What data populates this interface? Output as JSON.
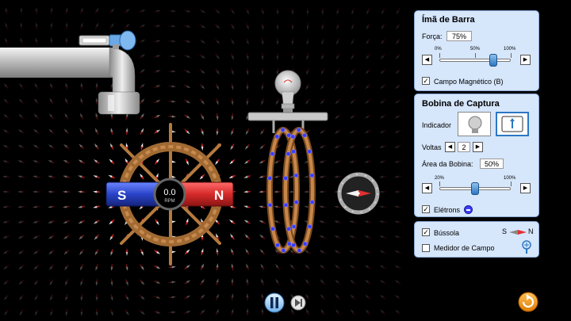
{
  "bar_magnet_panel": {
    "title": "Ímã de Barra",
    "strength_label": "Força:",
    "strength_value": "75%",
    "strength_fraction": 0.75,
    "tick_min": "0%",
    "tick_mid": "50%",
    "tick_max": "100%",
    "field_label": "Campo Magnético (B)",
    "field_checked": true
  },
  "pickup_coil_panel": {
    "title": "Bobina de Captura",
    "indicator_label": "Indicador",
    "loops_label": "Voltas",
    "loops_value": "2",
    "area_label": "Área da Bobina:",
    "area_value": "50%",
    "area_fraction": 0.5,
    "tick_min": "20%",
    "tick_max": "100%",
    "electrons_label": "Elétrons",
    "electrons_checked": true
  },
  "tools_panel": {
    "compass_label": "Bússola",
    "compass_checked": true,
    "compass_icon_s": "S",
    "compass_icon_n": "N",
    "field_meter_label": "Medidor de Campo",
    "field_meter_checked": false
  },
  "magnet": {
    "south_label": "S",
    "north_label": "N",
    "rpm_value": "0.0",
    "rpm_unit": "RPM"
  },
  "colors": {
    "panel_bg": "#d6e6fb",
    "north": "#d62a2a",
    "south": "#2a44c8",
    "electron": "#3c3cff",
    "coil": "#c27a3c",
    "accent": "#2b77c2"
  },
  "icons": {
    "play_pause": "pause-icon",
    "step": "step-icon",
    "reset": "reset-icon"
  }
}
